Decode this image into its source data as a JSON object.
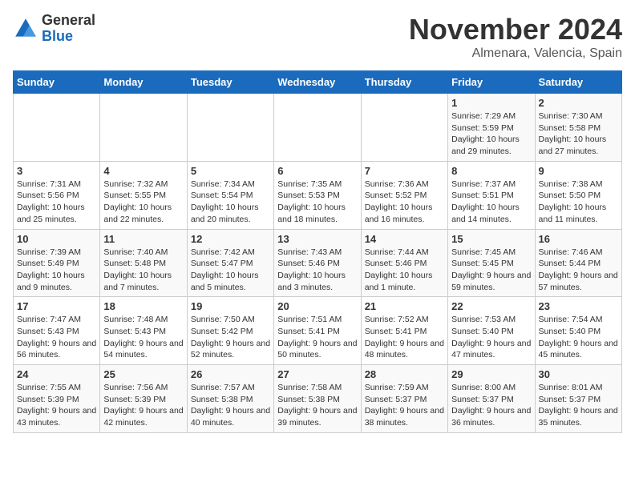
{
  "logo": {
    "general": "General",
    "blue": "Blue"
  },
  "title": {
    "month": "November 2024",
    "location": "Almenara, Valencia, Spain"
  },
  "weekdays": [
    "Sunday",
    "Monday",
    "Tuesday",
    "Wednesday",
    "Thursday",
    "Friday",
    "Saturday"
  ],
  "weeks": [
    [
      {
        "day": "",
        "info": ""
      },
      {
        "day": "",
        "info": ""
      },
      {
        "day": "",
        "info": ""
      },
      {
        "day": "",
        "info": ""
      },
      {
        "day": "",
        "info": ""
      },
      {
        "day": "1",
        "info": "Sunrise: 7:29 AM\nSunset: 5:59 PM\nDaylight: 10 hours and 29 minutes."
      },
      {
        "day": "2",
        "info": "Sunrise: 7:30 AM\nSunset: 5:58 PM\nDaylight: 10 hours and 27 minutes."
      }
    ],
    [
      {
        "day": "3",
        "info": "Sunrise: 7:31 AM\nSunset: 5:56 PM\nDaylight: 10 hours and 25 minutes."
      },
      {
        "day": "4",
        "info": "Sunrise: 7:32 AM\nSunset: 5:55 PM\nDaylight: 10 hours and 22 minutes."
      },
      {
        "day": "5",
        "info": "Sunrise: 7:34 AM\nSunset: 5:54 PM\nDaylight: 10 hours and 20 minutes."
      },
      {
        "day": "6",
        "info": "Sunrise: 7:35 AM\nSunset: 5:53 PM\nDaylight: 10 hours and 18 minutes."
      },
      {
        "day": "7",
        "info": "Sunrise: 7:36 AM\nSunset: 5:52 PM\nDaylight: 10 hours and 16 minutes."
      },
      {
        "day": "8",
        "info": "Sunrise: 7:37 AM\nSunset: 5:51 PM\nDaylight: 10 hours and 14 minutes."
      },
      {
        "day": "9",
        "info": "Sunrise: 7:38 AM\nSunset: 5:50 PM\nDaylight: 10 hours and 11 minutes."
      }
    ],
    [
      {
        "day": "10",
        "info": "Sunrise: 7:39 AM\nSunset: 5:49 PM\nDaylight: 10 hours and 9 minutes."
      },
      {
        "day": "11",
        "info": "Sunrise: 7:40 AM\nSunset: 5:48 PM\nDaylight: 10 hours and 7 minutes."
      },
      {
        "day": "12",
        "info": "Sunrise: 7:42 AM\nSunset: 5:47 PM\nDaylight: 10 hours and 5 minutes."
      },
      {
        "day": "13",
        "info": "Sunrise: 7:43 AM\nSunset: 5:46 PM\nDaylight: 10 hours and 3 minutes."
      },
      {
        "day": "14",
        "info": "Sunrise: 7:44 AM\nSunset: 5:46 PM\nDaylight: 10 hours and 1 minute."
      },
      {
        "day": "15",
        "info": "Sunrise: 7:45 AM\nSunset: 5:45 PM\nDaylight: 9 hours and 59 minutes."
      },
      {
        "day": "16",
        "info": "Sunrise: 7:46 AM\nSunset: 5:44 PM\nDaylight: 9 hours and 57 minutes."
      }
    ],
    [
      {
        "day": "17",
        "info": "Sunrise: 7:47 AM\nSunset: 5:43 PM\nDaylight: 9 hours and 56 minutes."
      },
      {
        "day": "18",
        "info": "Sunrise: 7:48 AM\nSunset: 5:43 PM\nDaylight: 9 hours and 54 minutes."
      },
      {
        "day": "19",
        "info": "Sunrise: 7:50 AM\nSunset: 5:42 PM\nDaylight: 9 hours and 52 minutes."
      },
      {
        "day": "20",
        "info": "Sunrise: 7:51 AM\nSunset: 5:41 PM\nDaylight: 9 hours and 50 minutes."
      },
      {
        "day": "21",
        "info": "Sunrise: 7:52 AM\nSunset: 5:41 PM\nDaylight: 9 hours and 48 minutes."
      },
      {
        "day": "22",
        "info": "Sunrise: 7:53 AM\nSunset: 5:40 PM\nDaylight: 9 hours and 47 minutes."
      },
      {
        "day": "23",
        "info": "Sunrise: 7:54 AM\nSunset: 5:40 PM\nDaylight: 9 hours and 45 minutes."
      }
    ],
    [
      {
        "day": "24",
        "info": "Sunrise: 7:55 AM\nSunset: 5:39 PM\nDaylight: 9 hours and 43 minutes."
      },
      {
        "day": "25",
        "info": "Sunrise: 7:56 AM\nSunset: 5:39 PM\nDaylight: 9 hours and 42 minutes."
      },
      {
        "day": "26",
        "info": "Sunrise: 7:57 AM\nSunset: 5:38 PM\nDaylight: 9 hours and 40 minutes."
      },
      {
        "day": "27",
        "info": "Sunrise: 7:58 AM\nSunset: 5:38 PM\nDaylight: 9 hours and 39 minutes."
      },
      {
        "day": "28",
        "info": "Sunrise: 7:59 AM\nSunset: 5:37 PM\nDaylight: 9 hours and 38 minutes."
      },
      {
        "day": "29",
        "info": "Sunrise: 8:00 AM\nSunset: 5:37 PM\nDaylight: 9 hours and 36 minutes."
      },
      {
        "day": "30",
        "info": "Sunrise: 8:01 AM\nSunset: 5:37 PM\nDaylight: 9 hours and 35 minutes."
      }
    ]
  ]
}
